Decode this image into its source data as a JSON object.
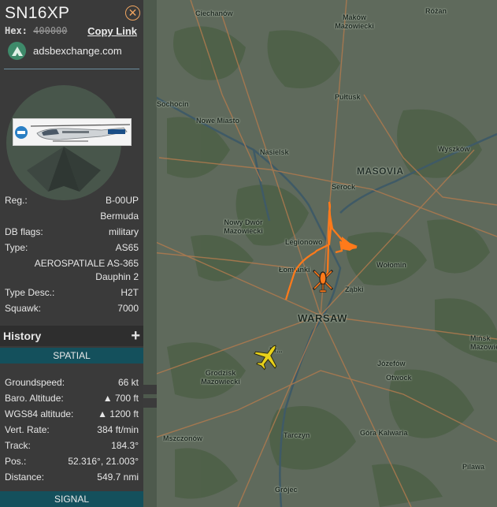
{
  "aircraft": {
    "callsign": "SN16XP",
    "hex_label": "Hex:",
    "hex_value": "400000",
    "copy_link": "Copy Link",
    "source": "adsbexchange.com"
  },
  "icons": {
    "close": "close-icon",
    "source_logo": "adsbexchange-logo-icon",
    "expand_history": "plus-icon",
    "aircraft_selected": "helicopter-icon",
    "aircraft_other": "airplane-icon"
  },
  "details": {
    "reg_label": "Reg.:",
    "reg_value": "B-00UP",
    "country": "Bermuda",
    "dbflags_label": "DB flags:",
    "dbflags_value": "military",
    "type_label": "Type:",
    "type_value": "AS65",
    "type_full": "AEROSPATIALE AS-365 Dauphin 2",
    "typedesc_label": "Type Desc.:",
    "typedesc_value": "H2T",
    "squawk_label": "Squawk:",
    "squawk_value": "7000"
  },
  "history": {
    "title": "History",
    "plus": "+"
  },
  "tabs": {
    "spatial": "SPATIAL",
    "signal": "SIGNAL"
  },
  "spatial": {
    "groundspeed_label": "Groundspeed:",
    "groundspeed_value": "66 kt",
    "baro_label": "Baro. Altitude:",
    "baro_value": "▲ 700 ft",
    "wgs_label": "WGS84 altitude:",
    "wgs_value": "▲ 1200 ft",
    "vrate_label": "Vert. Rate:",
    "vrate_value": "384 ft/min",
    "track_label": "Track:",
    "track_value": "184.3°",
    "pos_label": "Pos.:",
    "pos_value": "52.316°, 21.003°",
    "distance_label": "Distance:",
    "distance_value": "549.7 nmi"
  },
  "map": {
    "colors": {
      "base": "#5f6a5c",
      "forest": "#4d5f48",
      "road": "#b07a4e",
      "river": "#3f5a66",
      "track_selected": "#ff7a1a",
      "plane_other": "#e8d11a"
    },
    "places": {
      "ciechanow": "Ciechanów",
      "makow": "Maków Mazowiecki",
      "rozan": "Różan",
      "sochocin": "Sochocin",
      "pultusk": "Pułtusk",
      "nowe_miasto": "Nowe Miasto",
      "nasielsk": "Nasielsk",
      "wyszkow": "Wyszków",
      "masovia": "MASOVIA",
      "serock": "Serock",
      "nowy_dwor": "Nowy Dwór Mazowiecki",
      "legionowo": "Legionowo",
      "wolomin": "Wołomin",
      "lomianki": "Łomianki",
      "zabki": "Ząbki",
      "warsaw": "WARSAW",
      "minsk": "Mińsk Mazowiecki",
      "pruszkow": "Pr...",
      "jozefow": "Józefów",
      "grodzisk": "Grodzisk Mazowiecki",
      "otwock": "Otwock",
      "mszczonow": "Mszczonów",
      "tarczyn": "Tarczyn",
      "gora_kalwaria": "Góra Kalwaria",
      "pilawa": "Pilawa",
      "grojec": "Grójec"
    }
  }
}
